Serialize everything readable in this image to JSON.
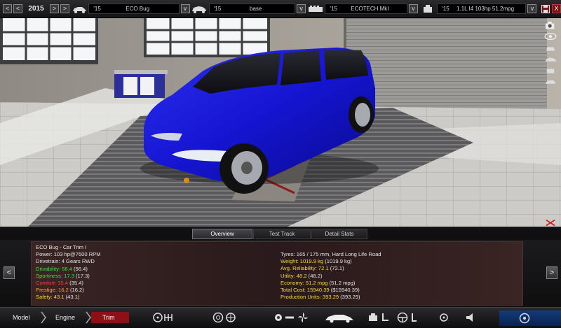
{
  "topbar": {
    "prev_label": "<",
    "next_label": ">",
    "year": "2015",
    "model": {
      "year": "'15",
      "name": "ECO Bug"
    },
    "trim": {
      "year": "'15",
      "name": "base"
    },
    "engine_family": {
      "year": "'15",
      "name": "ECOTECH MkI"
    },
    "engine": {
      "year": "'15",
      "name": "1.1L I4 103hp 51.2mpg"
    },
    "dropdown_glyph": "v",
    "close_glyph": "X"
  },
  "tabs": [
    {
      "label": "Overview",
      "active": true
    },
    {
      "label": "Test Track",
      "active": false
    },
    {
      "label": "Detail Stats",
      "active": false
    }
  ],
  "info": {
    "left": [
      {
        "label": "ECO Bug - Car Trim I",
        "value": "",
        "color": "w"
      },
      {
        "label": "Power: ",
        "value": "103 hp@7600 RPM",
        "color": "w"
      },
      {
        "label": "Drivetrain: ",
        "value": "4 Gears RWD",
        "color": "w"
      },
      {
        "label": "Drivability: 56.4",
        "value": " (56.4)",
        "color": "g"
      },
      {
        "label": "Sportiness: 17.3",
        "value": " (17.3)",
        "color": "g"
      },
      {
        "label": "Comfort: 35.4",
        "value": " (35.4)",
        "color": "r"
      },
      {
        "label": "Prestige: 16.2",
        "value": " (16.2)",
        "color": "o"
      },
      {
        "label": "Safety: 43.1",
        "value": " (43.1)",
        "color": "y"
      }
    ],
    "right": [
      {
        "label": "Tyres: ",
        "value": "165 / 175 mm, Hard Long Life Road",
        "color": "w"
      },
      {
        "label": "Weight: 1019.9 kg",
        "value": " (1019.9 kg)",
        "color": "y"
      },
      {
        "label": "Avg. Reliability: 72.1",
        "value": " (72.1)",
        "color": "y"
      },
      {
        "label": "Utility: 48.2",
        "value": " (48.2)",
        "color": "y"
      },
      {
        "label": "Economy: 51.2 mpg",
        "value": " (51.2 mpg)",
        "color": "y"
      },
      {
        "label": "Total Cost: 15940.39",
        "value": " ($15940.39)",
        "color": "y"
      },
      {
        "label": "Production Units: 393.29",
        "value": " (393.29)",
        "color": "y"
      }
    ]
  },
  "nav": {
    "prev_label": "<",
    "next_label": ">"
  },
  "bottombar": {
    "crumbs": [
      {
        "label": "Model",
        "active": false
      },
      {
        "label": "Engine",
        "active": false
      },
      {
        "label": "Trim",
        "active": true
      }
    ],
    "icons": [
      "steering-wheel-icon",
      "gearbox-icon",
      "wheel-icon",
      "suspension-icon",
      "brakes-icon",
      "fan-icon",
      "car-body-icon",
      "engine-bay-icon",
      "seat-icon",
      "safety-icon",
      "steering-icon",
      "lights-icon",
      "test-icon"
    ]
  },
  "colors": {
    "car": "#1616d8",
    "accent_red": "#8b1116",
    "panel": "#3a2424"
  }
}
